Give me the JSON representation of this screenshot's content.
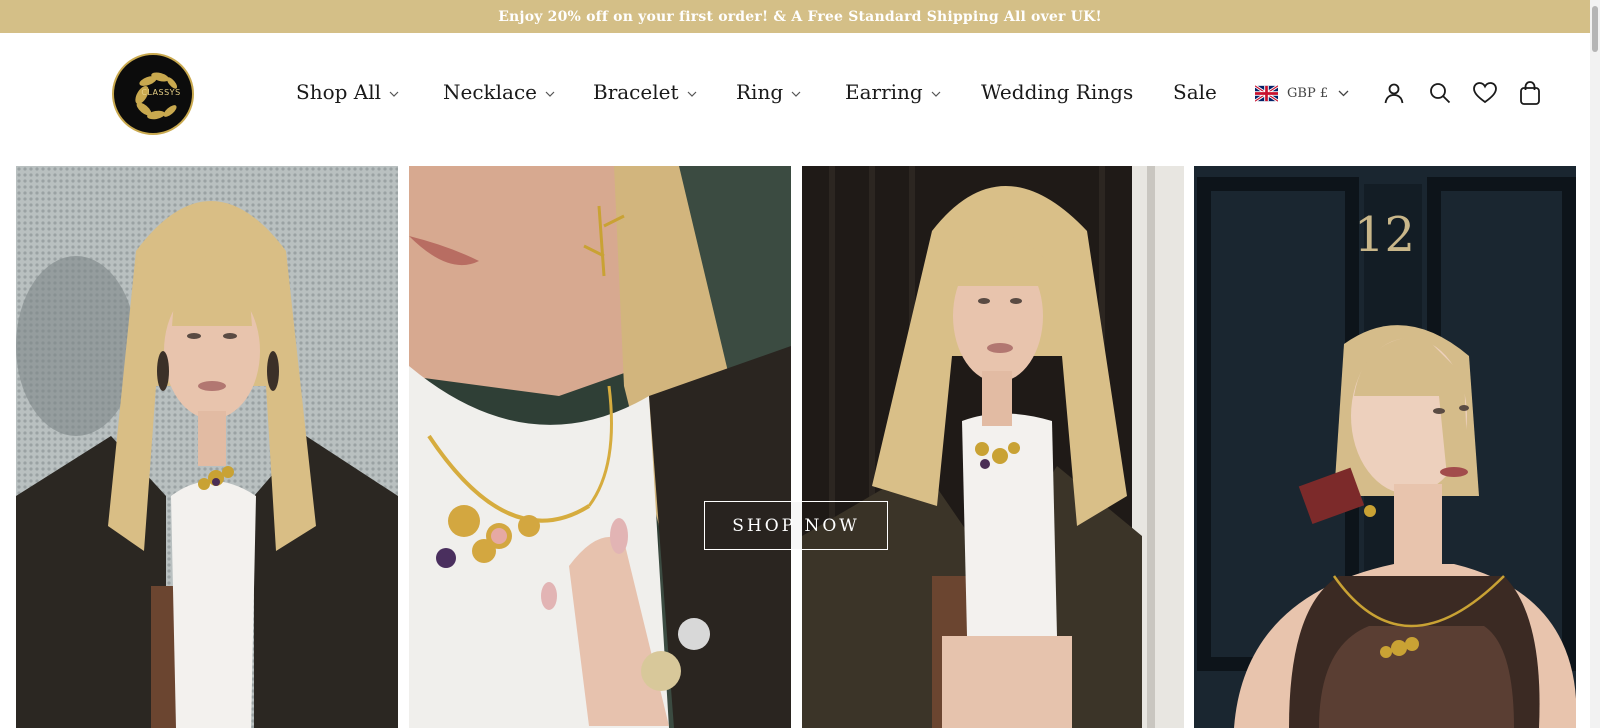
{
  "announcement": {
    "text": "Enjoy 20% off on your first order! & A Free Standard Shipping All over UK!"
  },
  "brand": {
    "logo_text": "CLASSYS",
    "accent_color": "#d4bf87"
  },
  "nav": {
    "items": [
      {
        "label": "Shop All",
        "has_dropdown": true
      },
      {
        "label": "Necklace",
        "has_dropdown": true
      },
      {
        "label": "Bracelet",
        "has_dropdown": true
      },
      {
        "label": "Ring",
        "has_dropdown": true
      },
      {
        "label": "Earring",
        "has_dropdown": true
      },
      {
        "label": "Wedding Rings",
        "has_dropdown": false
      },
      {
        "label": "Sale",
        "has_dropdown": false
      }
    ]
  },
  "currency": {
    "flag": "uk-flag-icon",
    "label": "GBP £"
  },
  "header_icons": [
    "account-icon",
    "search-icon",
    "wishlist-icon",
    "cart-icon"
  ],
  "hero": {
    "cta_label": "SHOP NOW",
    "door_number": "12"
  }
}
